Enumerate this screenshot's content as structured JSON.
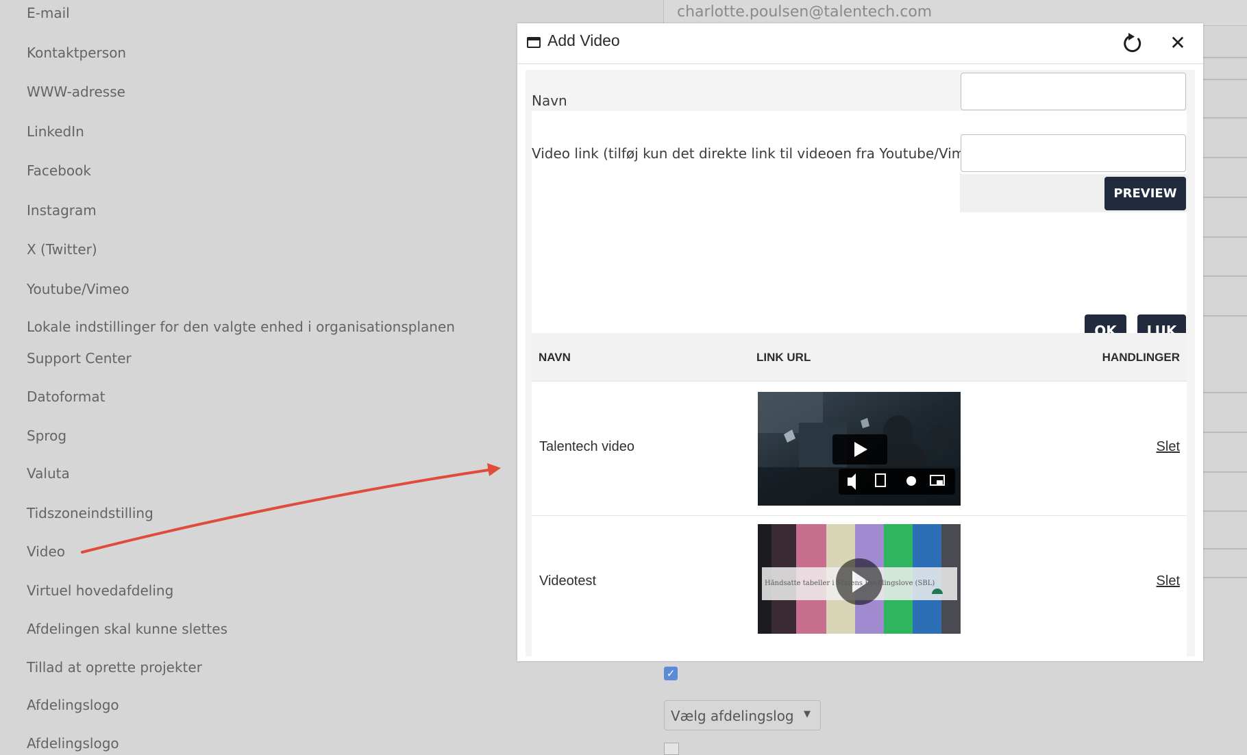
{
  "background": {
    "email_value": "charlotte.poulsen@talentech.com",
    "labels": [
      "E-mail",
      "Kontaktperson",
      "WWW-adresse",
      "LinkedIn",
      "Facebook",
      "Instagram",
      "X (Twitter)",
      "Youtube/Vimeo",
      "Lokale indstillinger for den valgte enhed i organisationsplanen",
      "Support Center",
      "Datoformat",
      "Sprog",
      "Valuta",
      "Tidszoneindstilling",
      "Video",
      "Virtuel hovedafdeling",
      "Afdelingen skal kunne slettes",
      "Tillad at oprette projekter",
      "Afdelingslogo",
      "Afdelingslogo"
    ],
    "checkbox_glyph": "✓",
    "logo_select_value": "Vælg afdelingslog",
    "logo_select_arrow": "▼"
  },
  "dialog": {
    "title": "Add Video",
    "refresh_icon": "refresh-icon",
    "close_glyph": "✕",
    "form": {
      "name_label": "Navn",
      "name_value": "",
      "link_label": "Video link (tilføj kun det direkte link til videoen fra Youtube/Vimeo)",
      "link_value": "",
      "preview_button": "PREVIEW",
      "ok_button": "OK",
      "close_button": "LUK"
    },
    "table": {
      "columns": [
        "NAVN",
        "LINK URL",
        "HANDLINGER"
      ],
      "rows": [
        {
          "name": "Talentech video",
          "action": "Slet"
        },
        {
          "name": "Videotest",
          "action": "Slet",
          "thumb_caption": "Håndsatte tabeller i Statens Byvillingslove (SBL)"
        }
      ]
    }
  },
  "colors": {
    "button_dark": "#222a3e",
    "overlay_gray": "#d6d6d6",
    "arrow_red": "#e04b3c",
    "checkbox_blue": "#5b8bd6"
  }
}
